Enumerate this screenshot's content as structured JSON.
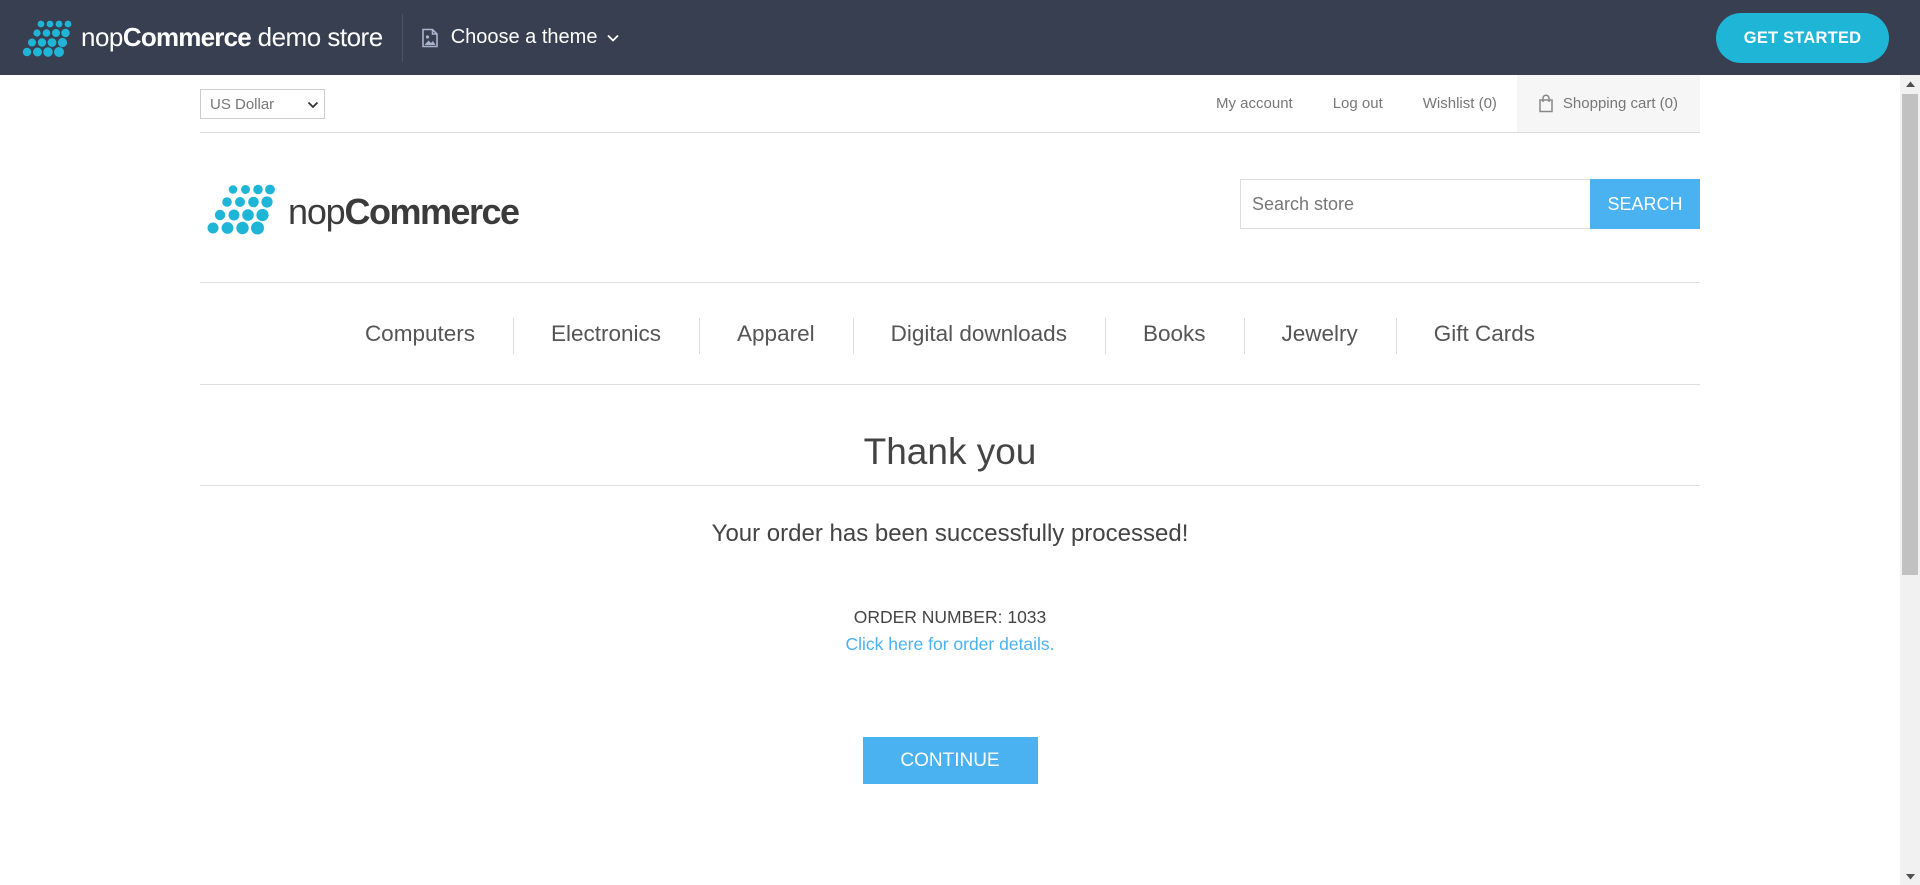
{
  "demo_bar": {
    "brand_light": "nop",
    "brand_bold": "Commerce",
    "brand_suffix": " demo store",
    "theme_label": "Choose a theme",
    "get_started_label": "GET STARTED",
    "background_color": "#373f50",
    "accent_color": "#1fb5d6"
  },
  "header": {
    "currency": "US Dollar",
    "links": {
      "my_account": "My account",
      "log_out": "Log out",
      "wishlist": "Wishlist (0)",
      "shopping_cart": "Shopping cart (0)"
    },
    "logo_light": "nop",
    "logo_bold": "Commerce",
    "search": {
      "placeholder": "Search store",
      "button_label": "SEARCH"
    }
  },
  "menu": {
    "items": [
      "Computers",
      "Electronics",
      "Apparel",
      "Digital downloads",
      "Books",
      "Jewelry",
      "Gift Cards"
    ]
  },
  "content": {
    "page_title": "Thank you",
    "message": "Your order has been successfully processed!",
    "order_number": "ORDER NUMBER: 1033",
    "details_link": "Click here for order details.",
    "continue_label": "CONTINUE",
    "accent_color": "#4ab2f1"
  },
  "icons": {
    "logo": "nopcommerce-dots-logo-icon",
    "theme": "image-icon",
    "dropdown": "chevron-down-icon",
    "cart": "shopping-bag-icon"
  }
}
